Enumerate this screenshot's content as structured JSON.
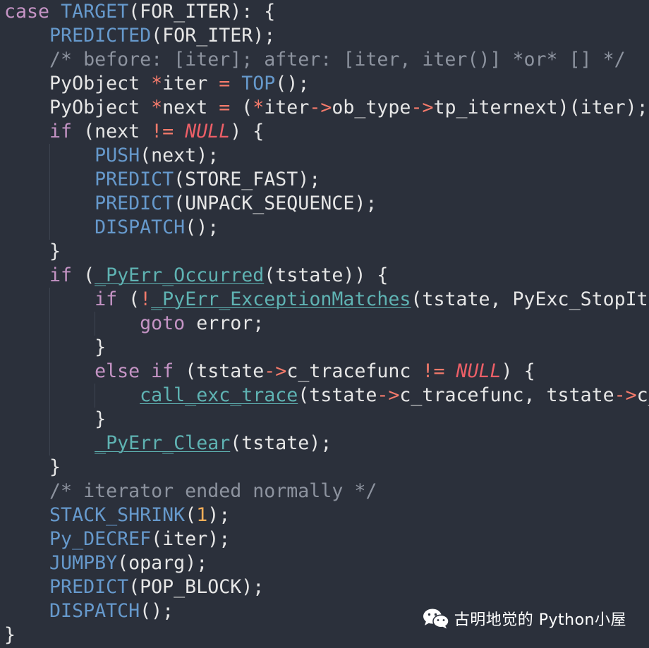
{
  "editor": {
    "lines": [
      [
        {
          "t": "case ",
          "k": "keyword"
        },
        {
          "t": "TARGET",
          "k": "macro"
        },
        {
          "t": "(FOR_ITER): {",
          "k": "plain"
        }
      ],
      [
        {
          "t": "    ",
          "k": "plain"
        },
        {
          "t": "PREDICTED",
          "k": "macro"
        },
        {
          "t": "(FOR_ITER);",
          "k": "plain"
        }
      ],
      [
        {
          "t": "    /* before: [iter]; after: [iter, iter()] *or* [] */",
          "k": "comment"
        }
      ],
      [
        {
          "t": "    PyObject ",
          "k": "plain"
        },
        {
          "t": "*",
          "k": "op"
        },
        {
          "t": "iter ",
          "k": "plain"
        },
        {
          "t": "=",
          "k": "op"
        },
        {
          "t": " ",
          "k": "plain"
        },
        {
          "t": "TOP",
          "k": "macro"
        },
        {
          "t": "();",
          "k": "plain"
        }
      ],
      [
        {
          "t": "    PyObject ",
          "k": "plain"
        },
        {
          "t": "*",
          "k": "op"
        },
        {
          "t": "next ",
          "k": "plain"
        },
        {
          "t": "=",
          "k": "op"
        },
        {
          "t": " (",
          "k": "plain"
        },
        {
          "t": "*",
          "k": "op"
        },
        {
          "t": "iter",
          "k": "plain"
        },
        {
          "t": "->",
          "k": "op"
        },
        {
          "t": "ob_type",
          "k": "plain"
        },
        {
          "t": "->",
          "k": "op"
        },
        {
          "t": "tp_iternext)(iter);",
          "k": "plain"
        }
      ],
      [
        {
          "t": "    ",
          "k": "plain"
        },
        {
          "t": "if",
          "k": "keyword"
        },
        {
          "t": " (next ",
          "k": "plain"
        },
        {
          "t": "!=",
          "k": "op"
        },
        {
          "t": " ",
          "k": "plain"
        },
        {
          "t": "NULL",
          "k": "null"
        },
        {
          "t": ") {",
          "k": "plain"
        }
      ],
      [
        {
          "t": "        ",
          "k": "plain"
        },
        {
          "t": "PUSH",
          "k": "macro"
        },
        {
          "t": "(next);",
          "k": "plain"
        }
      ],
      [
        {
          "t": "        ",
          "k": "plain"
        },
        {
          "t": "PREDICT",
          "k": "macro"
        },
        {
          "t": "(STORE_FAST);",
          "k": "plain"
        }
      ],
      [
        {
          "t": "        ",
          "k": "plain"
        },
        {
          "t": "PREDICT",
          "k": "macro"
        },
        {
          "t": "(UNPACK_SEQUENCE);",
          "k": "plain"
        }
      ],
      [
        {
          "t": "        ",
          "k": "plain"
        },
        {
          "t": "DISPATCH",
          "k": "macro"
        },
        {
          "t": "();",
          "k": "plain"
        }
      ],
      [
        {
          "t": "    }",
          "k": "plain"
        }
      ],
      [
        {
          "t": "    ",
          "k": "plain"
        },
        {
          "t": "if",
          "k": "keyword"
        },
        {
          "t": " (",
          "k": "plain"
        },
        {
          "t": "_PyErr_Occurred",
          "k": "func_u"
        },
        {
          "t": "(tstate)) {",
          "k": "plain"
        }
      ],
      [
        {
          "t": "        ",
          "k": "plain"
        },
        {
          "t": "if",
          "k": "keyword"
        },
        {
          "t": " (",
          "k": "plain"
        },
        {
          "t": "!",
          "k": "op"
        },
        {
          "t": "_PyErr_ExceptionMatches",
          "k": "func_u"
        },
        {
          "t": "(tstate, PyExc_StopIteration)) {",
          "k": "plain"
        }
      ],
      [
        {
          "t": "            ",
          "k": "plain"
        },
        {
          "t": "goto",
          "k": "keyword"
        },
        {
          "t": " error;",
          "k": "plain"
        }
      ],
      [
        {
          "t": "        }",
          "k": "plain"
        }
      ],
      [
        {
          "t": "        ",
          "k": "plain"
        },
        {
          "t": "else",
          "k": "keyword"
        },
        {
          "t": " ",
          "k": "plain"
        },
        {
          "t": "if",
          "k": "keyword"
        },
        {
          "t": " (tstate",
          "k": "plain"
        },
        {
          "t": "->",
          "k": "op"
        },
        {
          "t": "c_tracefunc ",
          "k": "plain"
        },
        {
          "t": "!=",
          "k": "op"
        },
        {
          "t": " ",
          "k": "plain"
        },
        {
          "t": "NULL",
          "k": "null"
        },
        {
          "t": ") {",
          "k": "plain"
        }
      ],
      [
        {
          "t": "            ",
          "k": "plain"
        },
        {
          "t": "call_exc_trace",
          "k": "func_u"
        },
        {
          "t": "(tstate",
          "k": "plain"
        },
        {
          "t": "->",
          "k": "op"
        },
        {
          "t": "c_tracefunc, tstate",
          "k": "plain"
        },
        {
          "t": "->",
          "k": "op"
        },
        {
          "t": "c_traceobj, tstate, f);",
          "k": "plain"
        }
      ],
      [
        {
          "t": "        }",
          "k": "plain"
        }
      ],
      [
        {
          "t": "        ",
          "k": "plain"
        },
        {
          "t": "_PyErr_Clear",
          "k": "func_u"
        },
        {
          "t": "(tstate);",
          "k": "plain"
        }
      ],
      [
        {
          "t": "    }",
          "k": "plain"
        }
      ],
      [
        {
          "t": "    /* iterator ended normally */",
          "k": "comment"
        }
      ],
      [
        {
          "t": "    ",
          "k": "plain"
        },
        {
          "t": "STACK_SHRINK",
          "k": "macro"
        },
        {
          "t": "(",
          "k": "plain"
        },
        {
          "t": "1",
          "k": "number"
        },
        {
          "t": ");",
          "k": "plain"
        }
      ],
      [
        {
          "t": "    ",
          "k": "plain"
        },
        {
          "t": "Py_DECREF",
          "k": "macro"
        },
        {
          "t": "(iter);",
          "k": "plain"
        }
      ],
      [
        {
          "t": "    ",
          "k": "plain"
        },
        {
          "t": "JUMPBY",
          "k": "macro"
        },
        {
          "t": "(oparg);",
          "k": "plain"
        }
      ],
      [
        {
          "t": "    ",
          "k": "plain"
        },
        {
          "t": "PREDICT",
          "k": "macro"
        },
        {
          "t": "(POP_BLOCK);",
          "k": "plain"
        }
      ],
      [
        {
          "t": "    ",
          "k": "plain"
        },
        {
          "t": "DISPATCH",
          "k": "macro"
        },
        {
          "t": "();",
          "k": "plain"
        }
      ],
      [
        {
          "t": "}",
          "k": "plain"
        }
      ]
    ]
  },
  "colors": {
    "background": "#2b303b",
    "keyword": "#c594c5",
    "macro": "#6699cc",
    "function": "#5fb3b3",
    "null": "#ec5f67",
    "comment": "#8d939f",
    "number": "#f9ae58",
    "plain": "#e6e6e6"
  },
  "watermark": {
    "icon": "wechat-icon",
    "text": "古明地觉的 Python小屋"
  }
}
